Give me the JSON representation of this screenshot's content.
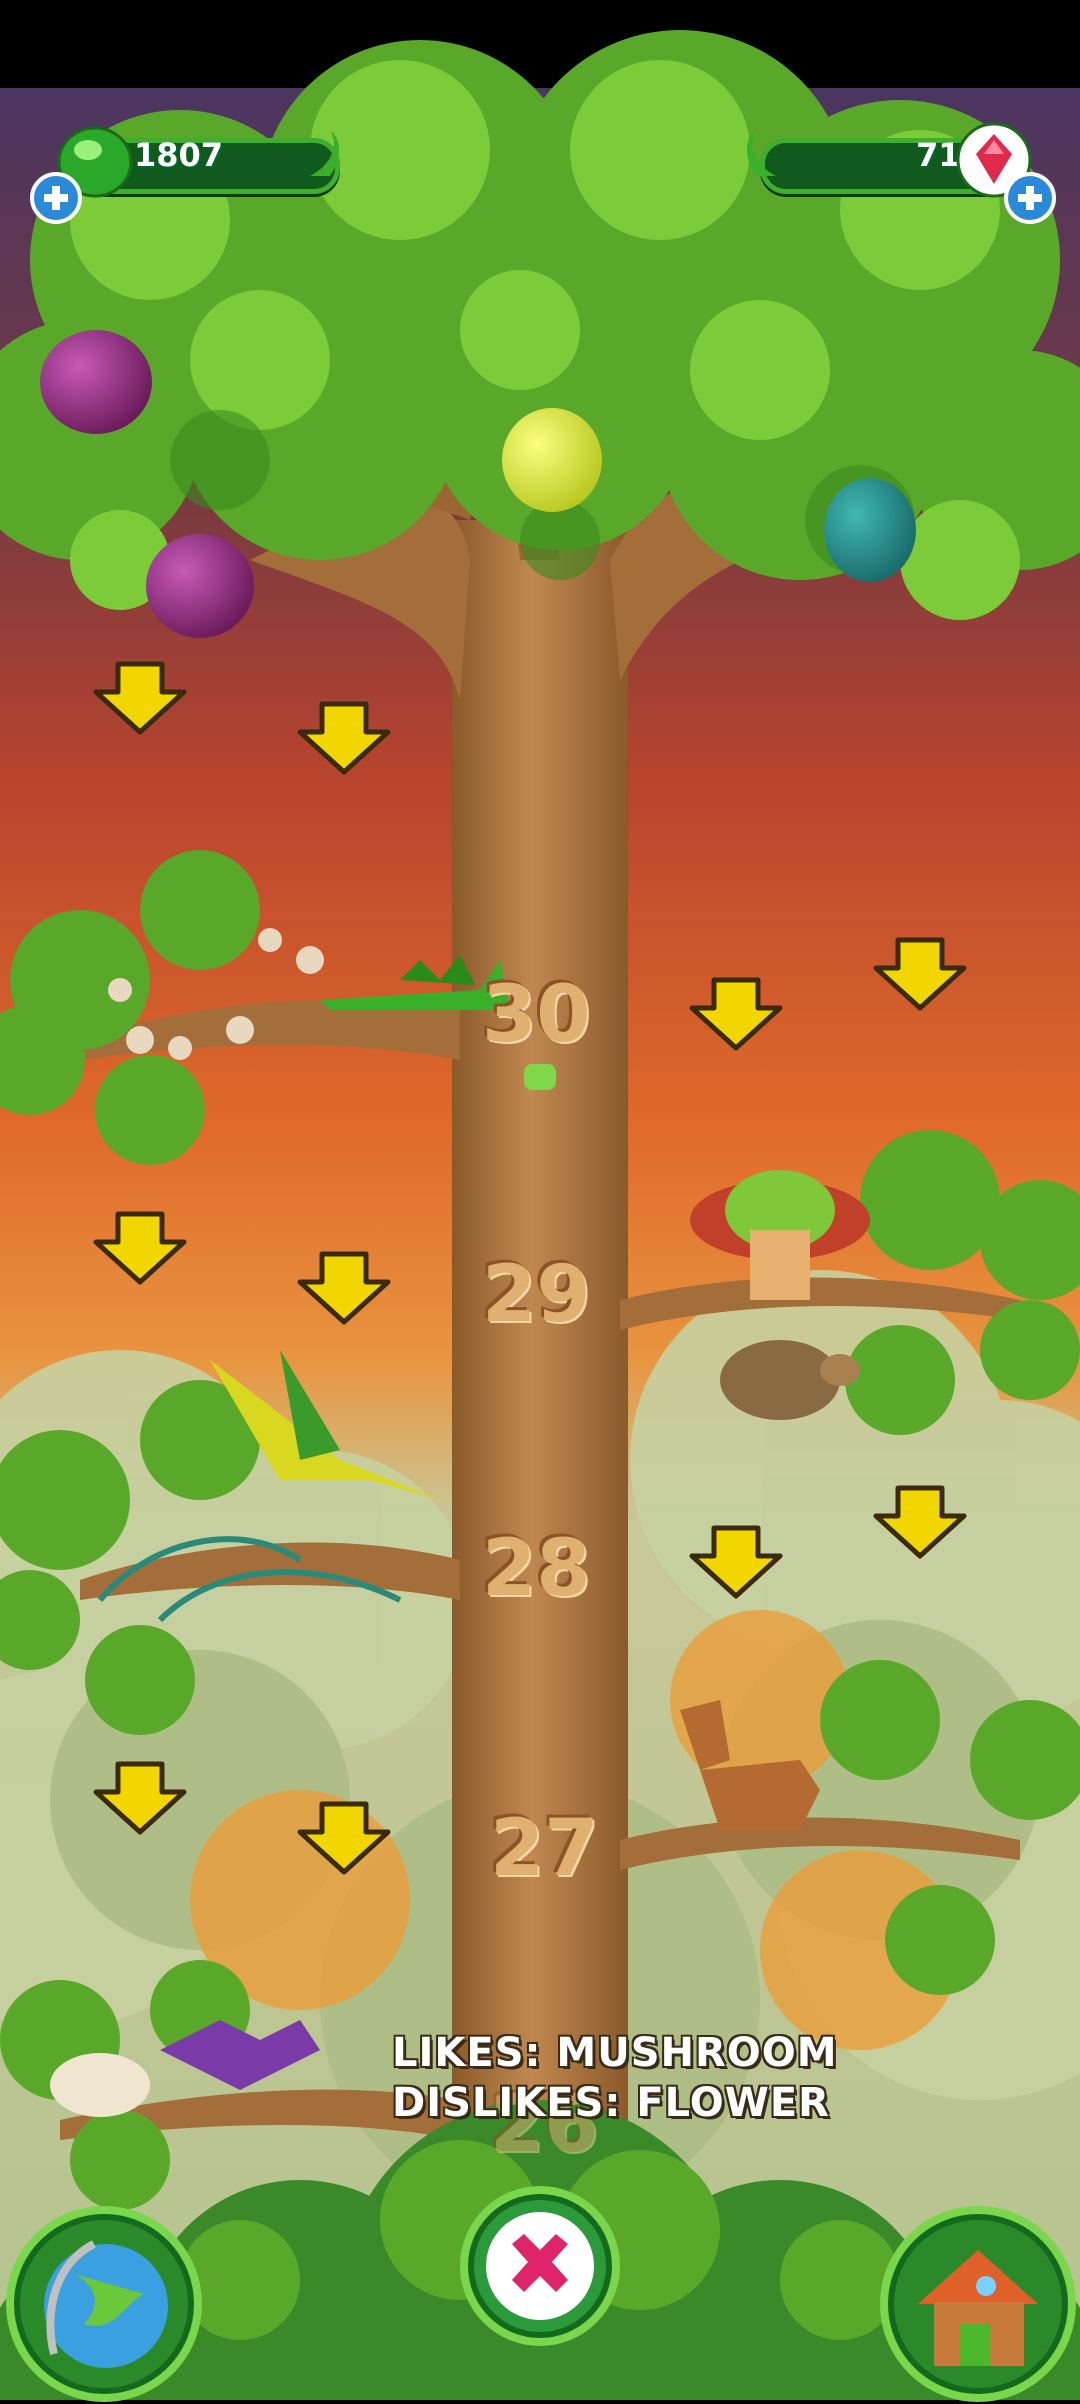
{
  "hud": {
    "currency": "1807",
    "gems": "71"
  },
  "levels": [
    "30",
    "29",
    "28",
    "27",
    "26"
  ],
  "info": {
    "likes": "LIKES: MUSHROOM",
    "dislikes": "DISLIKES: FLOWER"
  },
  "icons": {
    "globe": "globe-icon",
    "close": "close-icon",
    "house": "house-icon",
    "jelly": "green-jelly-icon",
    "gem": "red-gem-icon"
  },
  "colors": {
    "accent_green": "#3fae2c",
    "arrow_yellow": "#f2d600",
    "bark": "#b07840",
    "sky_top": "#5a3a6a",
    "sky_mid": "#d2542a"
  }
}
